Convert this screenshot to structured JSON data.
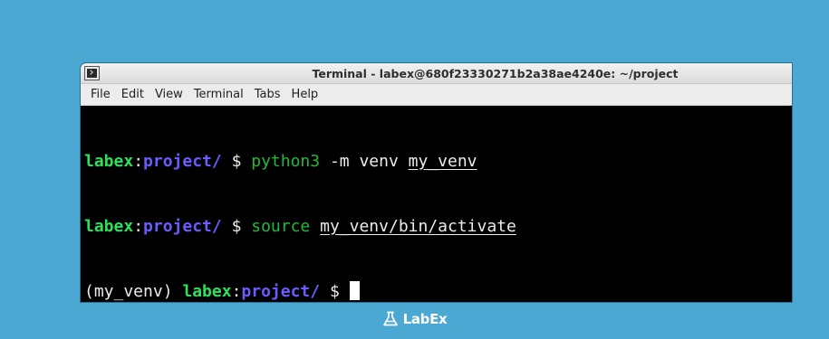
{
  "window": {
    "title": "Terminal - labex@680f23330271b2a38ae4240e: ~/project",
    "icon": "terminal-icon"
  },
  "menu": [
    "File",
    "Edit",
    "View",
    "Terminal",
    "Tabs",
    "Help"
  ],
  "terminal": {
    "lines": [
      {
        "prefix": "",
        "user": "labex",
        "colon": ":",
        "path": "project/",
        "dollar": " $ ",
        "cmd": "python3",
        "args": " -m venv ",
        "arg_u": "my_venv"
      },
      {
        "prefix": "",
        "user": "labex",
        "colon": ":",
        "path": "project/",
        "dollar": " $ ",
        "cmd": "source",
        "args": " ",
        "arg_u": "my_venv/bin/activate"
      },
      {
        "prefix": "(my_venv) ",
        "user": "labex",
        "colon": ":",
        "path": "project/",
        "dollar": " $ ",
        "cmd": "",
        "args": "",
        "arg_u": ""
      }
    ]
  },
  "footer": {
    "brand": "LabEx",
    "icon": "flask-icon"
  },
  "colors": {
    "desktop": "#4aa8d2",
    "prompt_user": "#2fe05a",
    "prompt_path": "#6a5cff",
    "command": "#23b83a"
  }
}
